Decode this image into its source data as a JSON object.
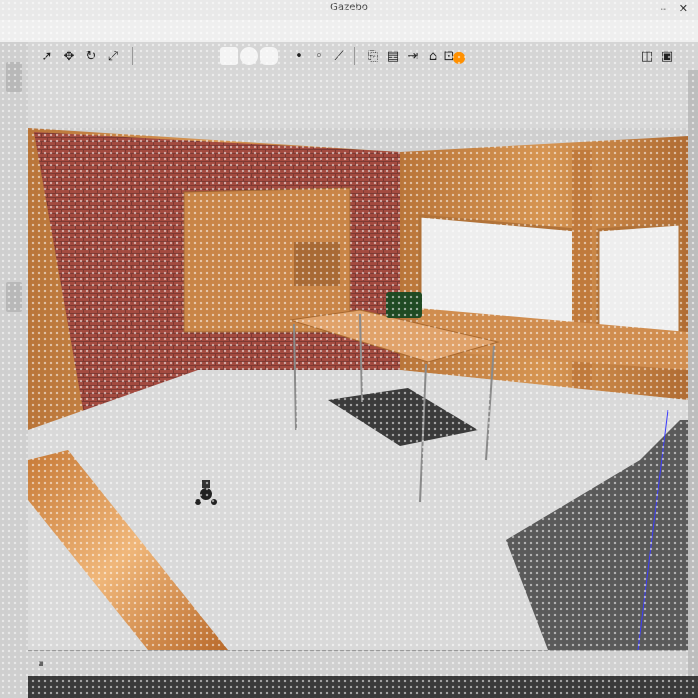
{
  "window": {
    "title": "Gazebo"
  },
  "toolbar": {
    "tools": [
      {
        "name": "select-tool-icon",
        "glyph": "➚"
      },
      {
        "name": "translate-tool-icon",
        "glyph": "✥"
      },
      {
        "name": "rotate-tool-icon",
        "glyph": "↻"
      },
      {
        "name": "scale-tool-icon",
        "glyph": "⤢"
      },
      {
        "name": "box-shape-icon",
        "glyph": ""
      },
      {
        "name": "sphere-shape-icon",
        "glyph": ""
      },
      {
        "name": "cylinder-shape-icon",
        "glyph": ""
      },
      {
        "name": "point-light-icon",
        "glyph": "•"
      },
      {
        "name": "spot-light-icon",
        "glyph": "◦"
      },
      {
        "name": "directional-light-icon",
        "glyph": "⟋"
      },
      {
        "name": "copy-icon",
        "glyph": "⎘"
      },
      {
        "name": "paste-icon",
        "glyph": "▤"
      },
      {
        "name": "align-icon",
        "glyph": "⇥"
      },
      {
        "name": "snap-icon",
        "glyph": "⌂"
      },
      {
        "name": "view-angle-icon",
        "glyph": "⊡"
      },
      {
        "name": "sun-icon",
        "glyph": "●"
      },
      {
        "name": "screenshot-icon",
        "glyph": "◫"
      },
      {
        "name": "record-icon",
        "glyph": "▣"
      }
    ]
  },
  "status": {
    "pause_glyph": "⏸"
  },
  "colors": {
    "wall_wood": "#c8864a",
    "brick": "#8a3b2f",
    "floor": "#d9d9d9",
    "toolbar": "#d5d5d5",
    "sun": "#ff9000"
  }
}
